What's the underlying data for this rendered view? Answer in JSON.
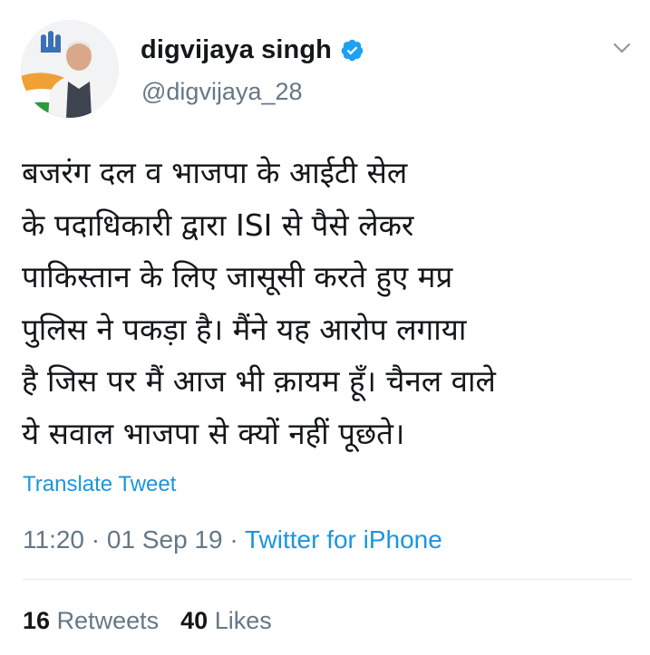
{
  "tweet": {
    "author": {
      "display_name": "digvijaya singh",
      "handle": "@digvijaya_28",
      "verified": true
    },
    "text": "बजरंग दल व भाजपा के आईटी सेल\nके पदाधिकारी द्वारा ISI से पैसे लेकर\nपाकिस्तान के लिए जासूसी करते हुए मप्र\nपुलिस ने पकड़ा है। मैंने यह आरोप  लगाया\nहै जिस पर मैं आज भी क़ायम हूँ। चैनल वाले\nये सवाल भाजपा से क्यों नहीं पूछते।",
    "translate_label": "Translate Tweet",
    "time": "11:20",
    "separator": " · ",
    "date": "01 Sep 19",
    "source": "Twitter for iPhone",
    "stats": {
      "retweets_count": "16",
      "retweets_label": "Retweets",
      "likes_count": "40",
      "likes_label": "Likes"
    }
  },
  "icons": {
    "verified": "verified-badge-icon",
    "menu": "chevron-down-icon"
  },
  "colors": {
    "link": "#1b95e0",
    "secondary_text": "#657786",
    "primary_text": "#14171a",
    "divider": "#e1e8ed"
  }
}
